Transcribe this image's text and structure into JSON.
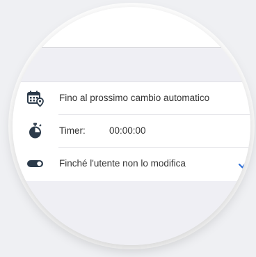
{
  "options": [
    {
      "label": "Fino al prossimo cambio automatico",
      "icon": "calendar-location-icon",
      "selected": false
    },
    {
      "label": "Timer:",
      "value": "00:00:00",
      "icon": "stopwatch-icon",
      "selected": false
    },
    {
      "label": "Finché l'utente non lo modifica",
      "icon": "toggle-icon",
      "selected": true
    }
  ],
  "colors": {
    "accent": "#2f6fd6",
    "icon": "#2b3a4a",
    "background": "#efeff4"
  }
}
